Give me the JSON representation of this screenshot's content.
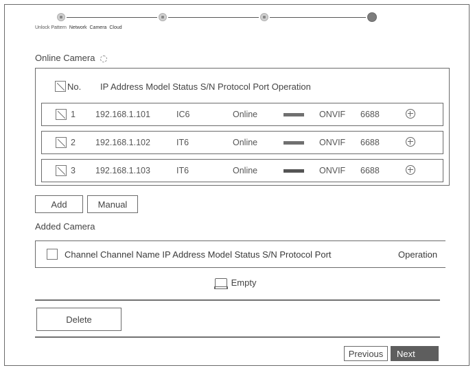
{
  "stepper": {
    "labels": [
      "Unlock Pattern",
      "Network",
      "Camera",
      "Cloud"
    ]
  },
  "online": {
    "title": "Online Camera",
    "headers": {
      "no": "No.",
      "rest": "IP Address Model Status S/N Protocol Port Operation"
    },
    "rows": [
      {
        "no": "1",
        "ip": "192.168.1.101",
        "model": "IC6",
        "status": "Online",
        "protocol": "ONVIF",
        "port": "6688"
      },
      {
        "no": "2",
        "ip": "192.168.1.102",
        "model": "IT6",
        "status": "Online",
        "protocol": "ONVIF",
        "port": "6688"
      },
      {
        "no": "3",
        "ip": "192.168.1.103",
        "model": "IT6",
        "status": "Online",
        "protocol": "ONVIF",
        "port": "6688"
      }
    ]
  },
  "buttons": {
    "add": "Add",
    "manual": "Manual",
    "delete": "Delete",
    "previous": "Previous",
    "next": "Next"
  },
  "added": {
    "title": "Added Camera",
    "headers": {
      "main": "Channel Channel Name  IP Address Model Status S/N Protocol Port",
      "operation": "Operation"
    },
    "empty": "Empty"
  }
}
